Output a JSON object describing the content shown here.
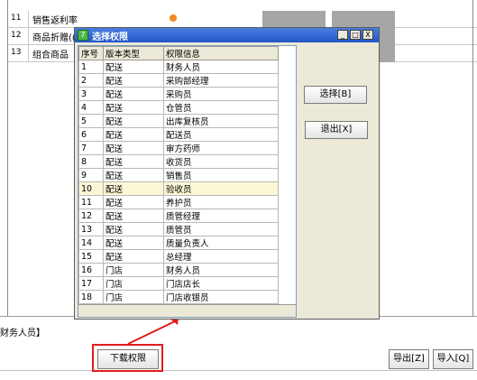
{
  "background_rows": [
    {
      "num": "11",
      "name": "销售返利率"
    },
    {
      "num": "12",
      "name": "商品折赠(("
    },
    {
      "num": "13",
      "name": "组合商品"
    }
  ],
  "dialog": {
    "title": "选择权限",
    "columns": [
      "序号",
      "版本类型",
      "权限信息"
    ],
    "rows": [
      [
        "1",
        "配送",
        "财务人员"
      ],
      [
        "2",
        "配送",
        "采购部经理"
      ],
      [
        "3",
        "配送",
        "采购员"
      ],
      [
        "4",
        "配送",
        "仓管员"
      ],
      [
        "5",
        "配送",
        "出库复核员"
      ],
      [
        "6",
        "配送",
        "配送员"
      ],
      [
        "7",
        "配送",
        "审方药师"
      ],
      [
        "8",
        "配送",
        "收货员"
      ],
      [
        "9",
        "配送",
        "销售员"
      ],
      [
        "10",
        "配送",
        "验收员"
      ],
      [
        "11",
        "配送",
        "养护员"
      ],
      [
        "12",
        "配送",
        "质管经理"
      ],
      [
        "13",
        "配送",
        "质管员"
      ],
      [
        "14",
        "配送",
        "质量负责人"
      ],
      [
        "15",
        "配送",
        "总经理"
      ],
      [
        "16",
        "门店",
        "财务人员"
      ],
      [
        "17",
        "门店",
        "门店店长"
      ],
      [
        "18",
        "门店",
        "门店收银员"
      ]
    ],
    "selected_row": "10",
    "select_label": "选择[B]",
    "exit_label": "退出[X]",
    "minimize_glyph": "_",
    "maximize_glyph": "□",
    "close_glyph": "X"
  },
  "status_text": "财务人员】",
  "buttons": {
    "download": "下载权限",
    "export": "导出[Z]",
    "import": "导入[Q]"
  },
  "colors": {
    "titlebar": "#2356c8",
    "highlight": "#e31b1b",
    "selected_row": "#fbf7d6",
    "orange_dot": "#f28a1e"
  }
}
